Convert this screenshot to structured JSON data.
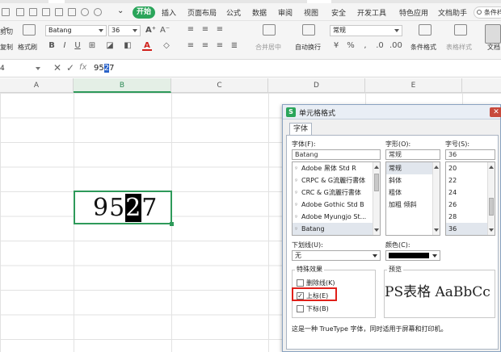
{
  "menu": {
    "start": "开始",
    "items": [
      "插入",
      "页面布局",
      "公式",
      "数据",
      "审阅",
      "视图",
      "安全",
      "开发工具",
      "特色应用",
      "文档助手"
    ],
    "search": "条件样"
  },
  "ribbon": {
    "cut": "剪切",
    "copy": "复制",
    "format_painter": "格式刷",
    "font_name": "Batang",
    "font_size": "36",
    "bold": "B",
    "italic": "I",
    "underline": "U",
    "font_color_glyph": "A",
    "merge_center": "合并居中",
    "wrap_text": "自动换行",
    "number_format": "常规",
    "conditional_format": "条件格式",
    "table_style": "表格样式",
    "doc_helper": "文档"
  },
  "formula_bar": {
    "name_box": "4",
    "value_before": "95",
    "value_selected": "2",
    "value_after": "7",
    "cancel_glyph": "✕",
    "ok_glyph": "✓",
    "fx_glyph": "fx"
  },
  "columns": [
    "A",
    "B",
    "C",
    "D",
    "E"
  ],
  "cell": {
    "before": "95",
    "highlighted": "2",
    "after": "7"
  },
  "dialog": {
    "title": "单元格格式",
    "logo": "S",
    "close": "✕",
    "tab": "字体",
    "font_label": "字体(F):",
    "font_value": "Batang",
    "font_list": [
      "Adobe 黑体 Std R",
      "CRPC & G流麗行書体",
      "CRC & G流麗行書体",
      "Adobe Gothic Std B",
      "Adobe Myungjo St...",
      "Batang"
    ],
    "style_label": "字形(O):",
    "style_value": "常规",
    "style_list": [
      "常规",
      "斜体",
      "粗体",
      "加粗 倾斜"
    ],
    "size_label": "字号(S):",
    "size_value": "36",
    "size_list": [
      "20",
      "22",
      "24",
      "26",
      "28",
      "36"
    ],
    "underline_label": "下划线(U):",
    "underline_value": "无",
    "color_label": "颜色(C):",
    "color_swatch": "#000000",
    "effects_title": "特殊效果",
    "strikethrough": "删除线(K)",
    "superscript": "上标(E)",
    "subscript": "下标(B)",
    "superscript_checked": true,
    "preview_title": "预览",
    "preview_text": "PS表格  AaBbCc",
    "footer": "这是一种 TrueType 字体，同时适用于屏幕和打印机。"
  }
}
